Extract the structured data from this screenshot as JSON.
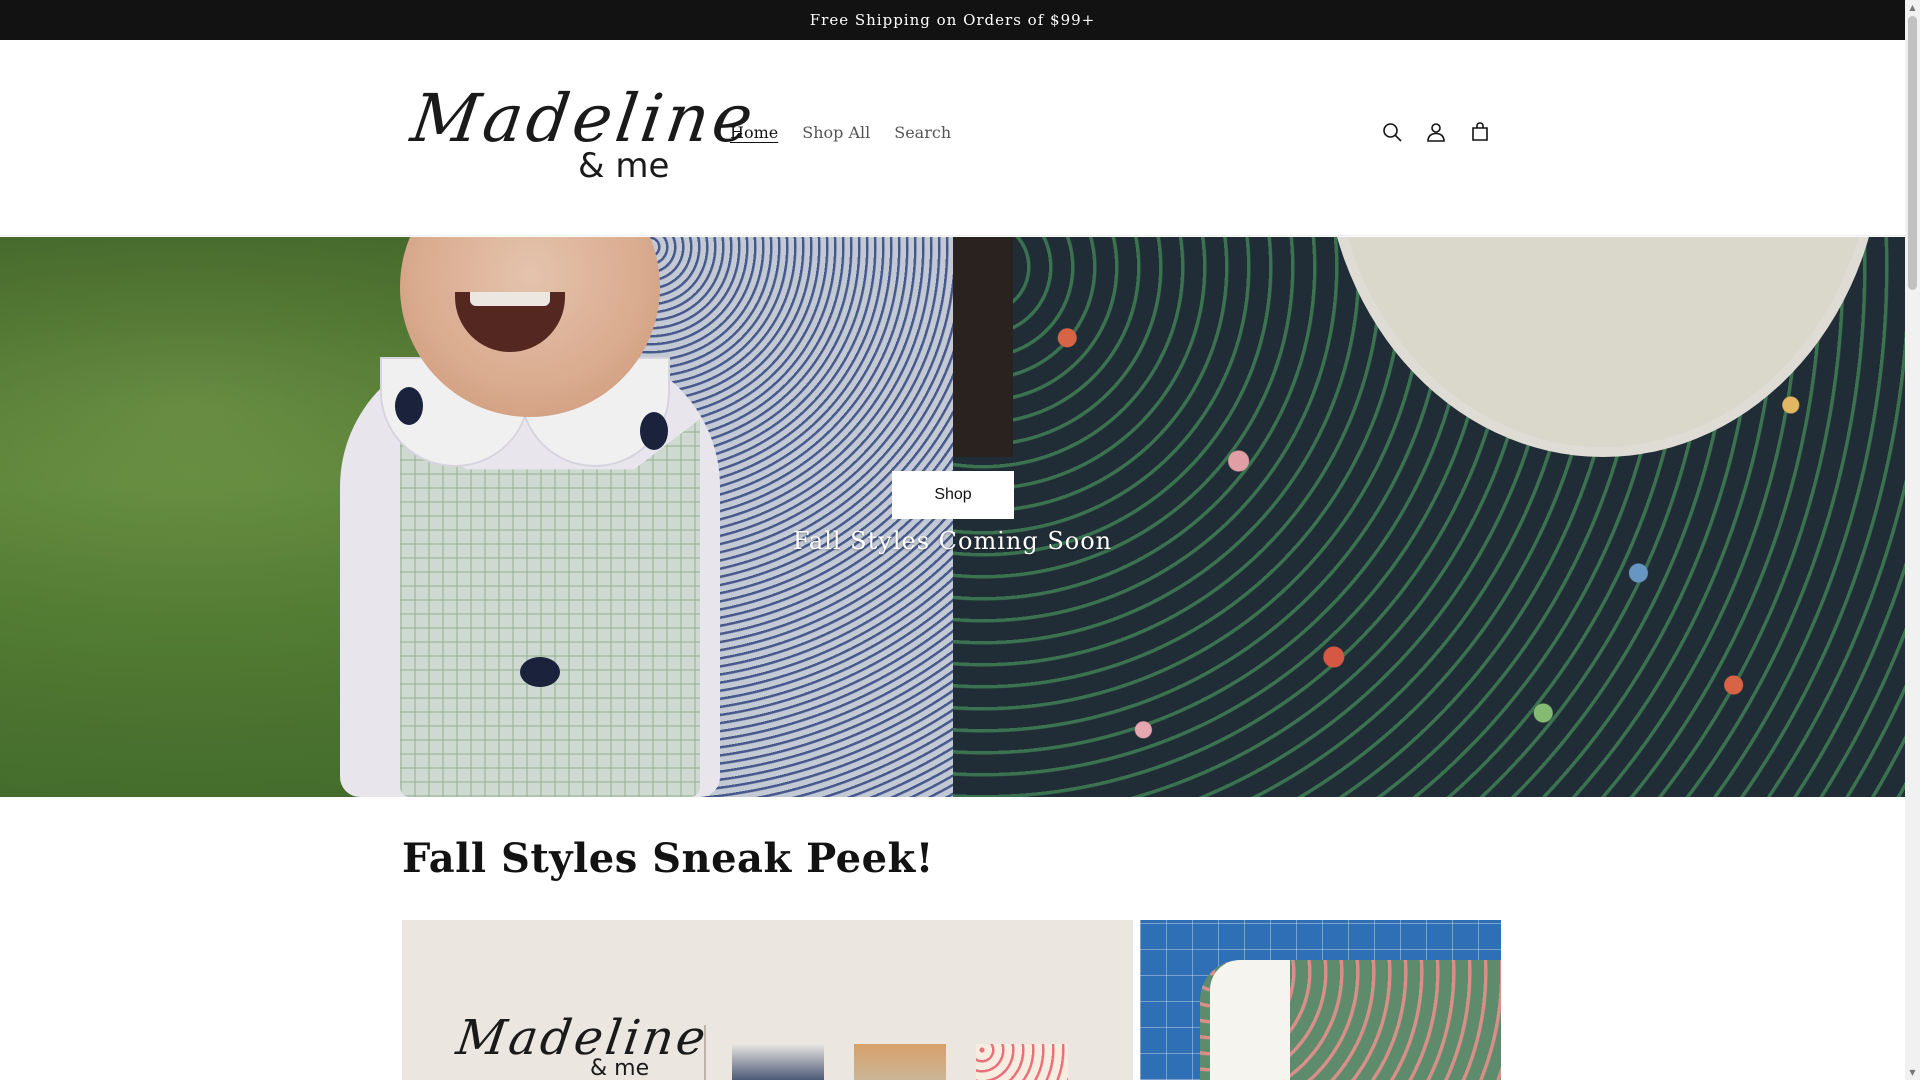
{
  "announcement": {
    "text": "Free Shipping on Orders of $99+"
  },
  "header": {
    "logo": {
      "script": "Madeline",
      "sub": "& me"
    },
    "nav": [
      {
        "label": "Home",
        "active": true
      },
      {
        "label": "Shop All",
        "active": false
      },
      {
        "label": "Search",
        "active": false
      }
    ],
    "icons": [
      "search-icon",
      "account-icon",
      "cart-icon"
    ]
  },
  "hero": {
    "button_label": "Shop",
    "heading": "Fall Styles Coming Soon"
  },
  "section": {
    "title": "Fall Styles Sneak Peek!",
    "card_logo": {
      "script": "Madeline",
      "sub": "& me"
    }
  },
  "colors": {
    "announcement_bg": "#121212",
    "text": "#121212",
    "nav_muted": "#555555",
    "scroll_thumb": "#c1c1c1"
  }
}
